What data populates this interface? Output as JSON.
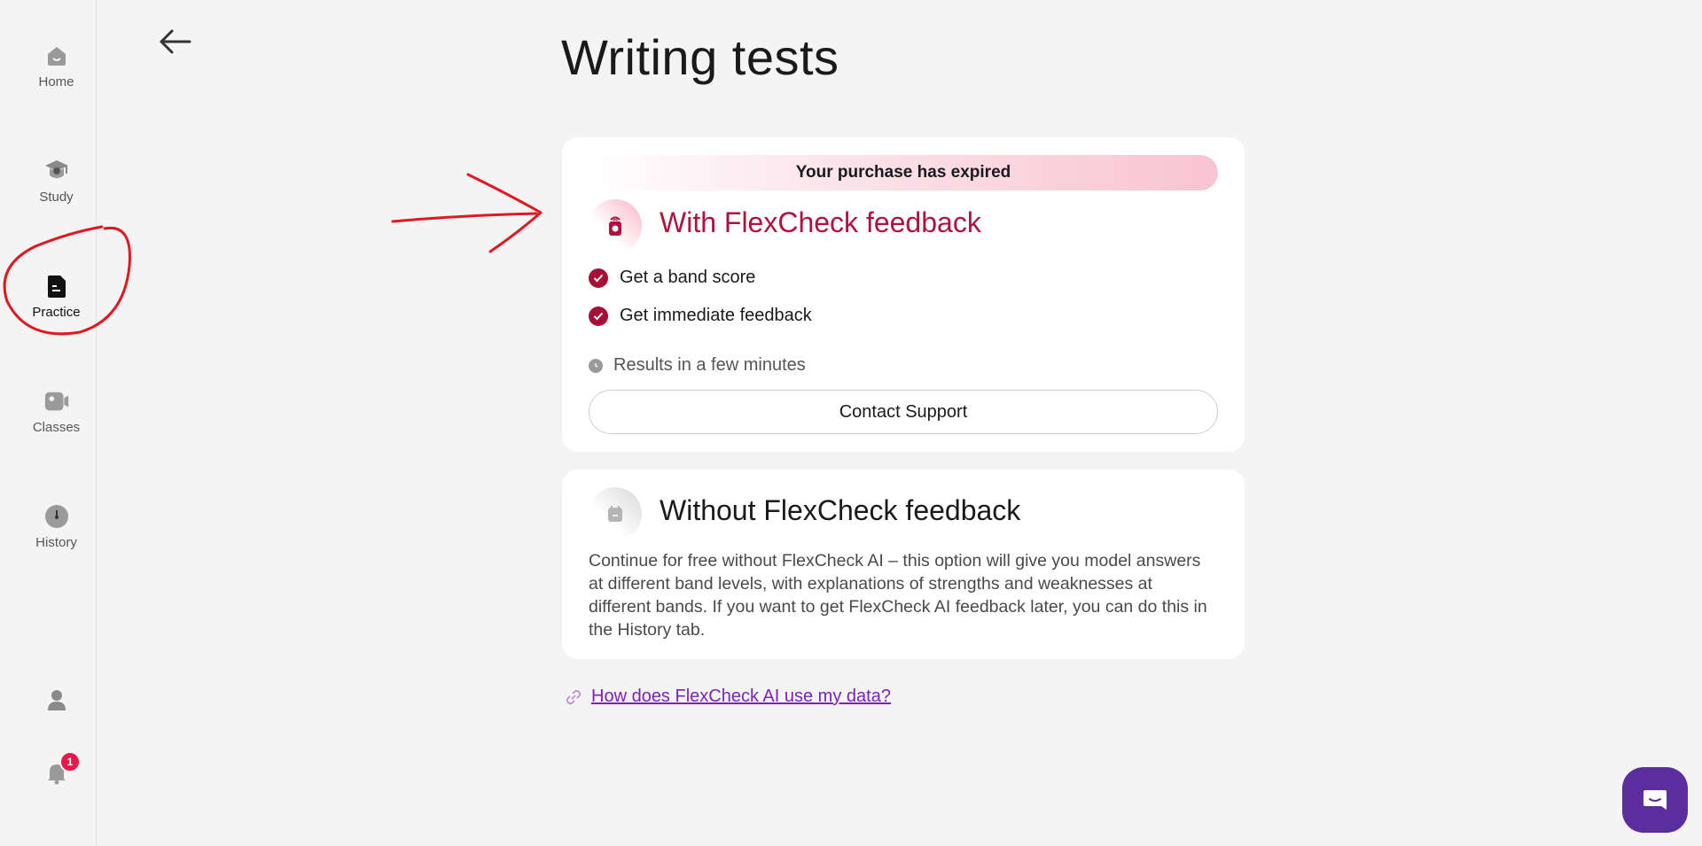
{
  "sidebar": {
    "items": [
      {
        "label": "Home",
        "icon": "home-icon"
      },
      {
        "label": "Study",
        "icon": "graduation-cap-icon"
      },
      {
        "label": "Practice",
        "icon": "document-icon"
      },
      {
        "label": "Classes",
        "icon": "video-camera-icon"
      },
      {
        "label": "History",
        "icon": "clock-icon"
      }
    ],
    "profile_icon": "user-icon",
    "notifications": {
      "icon": "bell-icon",
      "count": "1"
    }
  },
  "page": {
    "title": "Writing tests"
  },
  "with_feedback": {
    "banner": "Your purchase has expired",
    "title": "With FlexCheck feedback",
    "features": [
      "Get a band score",
      "Get immediate feedback"
    ],
    "results_text": "Results in a few minutes",
    "contact_label": "Contact Support",
    "accent_color": "#b0123e"
  },
  "without_feedback": {
    "title": "Without FlexCheck feedback",
    "description": "Continue for free without FlexCheck AI – this option will give you model answers at different band levels, with explanations of strengths and weaknesses at different bands. If you want to get FlexCheck AI feedback later, you can do this in the History tab."
  },
  "data_link": {
    "label": "How does FlexCheck AI use my data?",
    "color": "#7b22b8"
  },
  "colors": {
    "annotation": "#e0181f",
    "chat_button": "#5b2d9f",
    "badge": "#e8194a"
  }
}
